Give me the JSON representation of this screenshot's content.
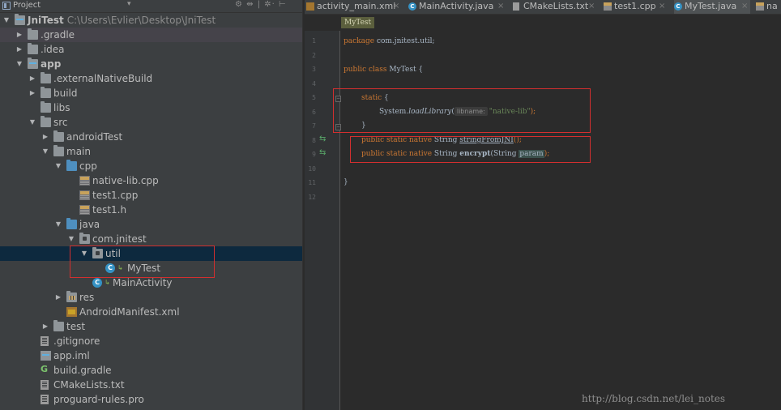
{
  "project_panel": {
    "header": {
      "title": "Project",
      "dropdown_glyph": "▾",
      "tools": "⚙ ⇹ | ✲· ⊢"
    },
    "tree": [
      {
        "label": "JniTest",
        "path": "C:\\Users\\Evlier\\Desktop\\JniTest",
        "bold": true,
        "arrow": "▼",
        "icon": "module-folder-icon",
        "state": "expanded"
      },
      {
        "label": ".gradle",
        "arrow": "▶",
        "icon": "folder-icon",
        "state": "collapsed"
      },
      {
        "label": ".idea",
        "arrow": "▶",
        "icon": "folder-icon",
        "state": "collapsed"
      },
      {
        "label": "app",
        "bold": true,
        "arrow": "▼",
        "icon": "module-folder-icon",
        "state": "expanded"
      },
      {
        "label": ".externalNativeBuild",
        "arrow": "▶",
        "icon": "folder-icon",
        "state": "collapsed"
      },
      {
        "label": "build",
        "arrow": "▶",
        "icon": "folder-icon",
        "state": "collapsed"
      },
      {
        "label": "libs",
        "arrow": "",
        "icon": "folder-icon",
        "state": "leaf"
      },
      {
        "label": "src",
        "arrow": "▼",
        "icon": "folder-icon",
        "state": "expanded"
      },
      {
        "label": "androidTest",
        "arrow": "▶",
        "icon": "folder-icon",
        "state": "collapsed"
      },
      {
        "label": "main",
        "arrow": "▼",
        "icon": "folder-icon",
        "state": "expanded"
      },
      {
        "label": "cpp",
        "arrow": "▼",
        "icon": "source-folder-icon",
        "state": "expanded"
      },
      {
        "label": "native-lib.cpp",
        "arrow": "",
        "icon": "cpp-file-icon",
        "state": "leaf"
      },
      {
        "label": "test1.cpp",
        "arrow": "",
        "icon": "cpp-file-icon",
        "state": "leaf"
      },
      {
        "label": "test1.h",
        "arrow": "",
        "icon": "header-file-icon",
        "state": "leaf"
      },
      {
        "label": "java",
        "arrow": "▼",
        "icon": "source-folder-icon",
        "state": "expanded"
      },
      {
        "label": "com.jnitest",
        "arrow": "▼",
        "icon": "package-icon",
        "state": "expanded"
      },
      {
        "label": "util",
        "arrow": "▼",
        "icon": "package-icon",
        "state": "expanded"
      },
      {
        "label": "MyTest",
        "arrow": "",
        "icon": "java-class-icon",
        "state": "leaf"
      },
      {
        "label": "MainActivity",
        "arrow": "",
        "icon": "java-class-icon",
        "state": "leaf"
      },
      {
        "label": "res",
        "arrow": "▶",
        "icon": "resource-folder-icon",
        "state": "collapsed"
      },
      {
        "label": "AndroidManifest.xml",
        "arrow": "",
        "icon": "xml-file-icon",
        "state": "leaf"
      },
      {
        "label": "test",
        "arrow": "▶",
        "icon": "folder-icon",
        "state": "collapsed"
      },
      {
        "label": ".gitignore",
        "arrow": "",
        "icon": "text-file-icon",
        "state": "leaf"
      },
      {
        "label": "app.iml",
        "arrow": "",
        "icon": "iml-file-icon",
        "state": "leaf"
      },
      {
        "label": "build.gradle",
        "arrow": "",
        "icon": "gradle-file-icon",
        "state": "leaf"
      },
      {
        "label": "CMakeLists.txt",
        "arrow": "",
        "icon": "text-file-icon",
        "state": "leaf"
      },
      {
        "label": "proguard-rules.pro",
        "arrow": "",
        "icon": "text-file-icon",
        "state": "leaf"
      }
    ]
  },
  "editor": {
    "tabs": [
      {
        "label": "activity_main.xml",
        "icon": "xml-file-icon",
        "active": false,
        "close": "×"
      },
      {
        "label": "MainActivity.java",
        "icon": "java-class-icon",
        "active": false,
        "close": "×"
      },
      {
        "label": "CMakeLists.txt",
        "icon": "text-file-icon",
        "active": false,
        "close": "×"
      },
      {
        "label": "test1.cpp",
        "icon": "cpp-file-icon",
        "active": false,
        "close": "×"
      },
      {
        "label": "MyTest.java",
        "icon": "java-class-icon",
        "active": true,
        "close": "×"
      },
      {
        "label": "na",
        "icon": "cpp-file-icon",
        "active": false,
        "close": ""
      }
    ],
    "breadcrumb": "MyTest",
    "line_numbers": [
      "1",
      "2",
      "3",
      "4",
      "5",
      "6",
      "7",
      "8",
      "9",
      "10",
      "11",
      "12"
    ],
    "gutter_markers": {
      "8": "⇆",
      "9": "⇆"
    },
    "code": {
      "l1_kw": "package",
      "l1_rest": " com.jnitest.util;",
      "l3_kw1": "public",
      "l3_kw2": "class",
      "l3_rest": " MyTest {",
      "l5_kw": "static",
      "l5_rest": " {",
      "l6_obj": "System.",
      "l6_method": "loadLibrary",
      "l6_open": "(",
      "l6_hint": "libname:",
      "l6_str": "\"native-lib\"",
      "l6_close": ");",
      "l7": "}",
      "l8_kw": "public static native",
      "l8_type": " String ",
      "l8_method": "stringFromJNI",
      "l8_close": "();",
      "l9_kw": "public static native",
      "l9_type": " String ",
      "l9_method": "encrypt",
      "l9_args_open": "(String ",
      "l9_param": "param",
      "l9_close": ");",
      "l12": "}"
    }
  },
  "watermark": "http://blog.csdn.net/lei_notes",
  "colors": {
    "keyword": "#cc7832",
    "string": "#6a8759",
    "text": "#a9b7c6",
    "panel_bg": "#3c3f41",
    "editor_bg": "#2b2b2b",
    "selection": "#0d293e",
    "annotation_box": "#d32f2f"
  }
}
